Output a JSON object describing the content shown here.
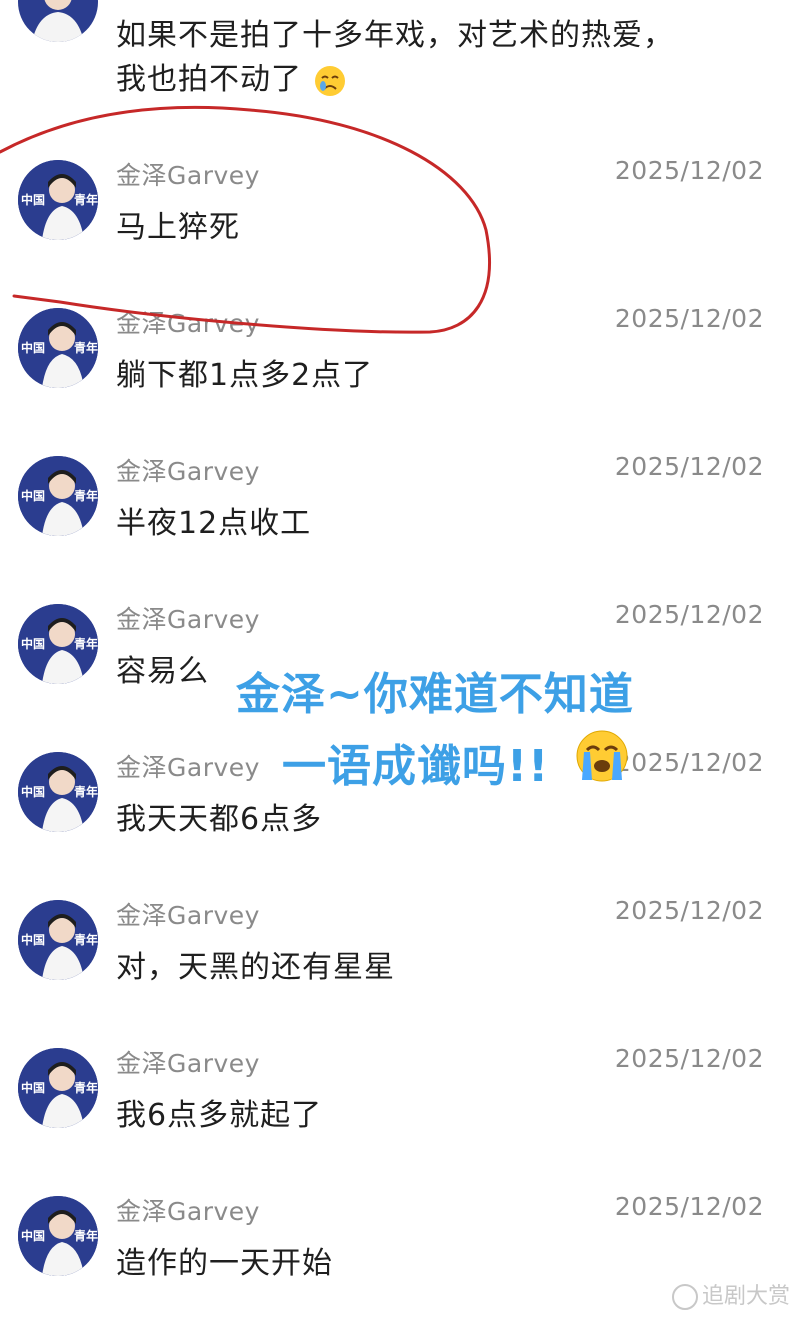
{
  "top_message": {
    "line1": "如果不是拍了十多年戏，对艺术的热爱，",
    "line2": "我也拍不动了",
    "emoji": "crying-face"
  },
  "avatar": {
    "label_left": "中国",
    "label_right": "青年",
    "bg_color": "#2b3d8f"
  },
  "messages": [
    {
      "name": "金泽Garvey",
      "time": "2025/12/02",
      "text": "马上猝死"
    },
    {
      "name": "金泽Garvey",
      "time": "2025/12/02",
      "text": "躺下都1点多2点了"
    },
    {
      "name": "金泽Garvey",
      "time": "2025/12/02",
      "text": "半夜12点收工"
    },
    {
      "name": "金泽Garvey",
      "time": "2025/12/02",
      "text": "容易么"
    },
    {
      "name": "金泽Garvey",
      "time": "2025/12/02",
      "text": "我天天都6点多"
    },
    {
      "name": "金泽Garvey",
      "time": "2025/12/02",
      "text": "对，天黑的还有星星"
    },
    {
      "name": "金泽Garvey",
      "time": "2025/12/02",
      "text": "我6点多就起了"
    },
    {
      "name": "金泽Garvey",
      "time": "2025/12/02",
      "text": "造作的一天开始"
    }
  ],
  "caption": {
    "line1": "金泽~你难道不知道",
    "line2": "一语成谶吗!!",
    "color": "#3da0e6",
    "emoji": "loudly-crying-face"
  },
  "highlight": {
    "color": "#c62828"
  },
  "watermark": {
    "text": "追剧大赏"
  }
}
